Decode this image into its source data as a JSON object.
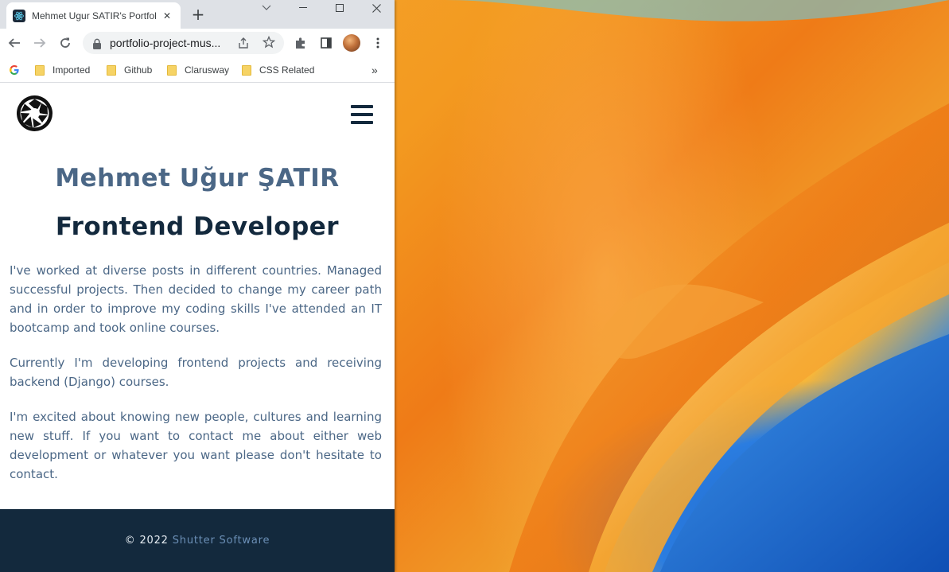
{
  "browser": {
    "tab": {
      "title": "Mehmet Ugur SATIR's Portfolio"
    },
    "address_bar": {
      "url": "portfolio-project-mus..."
    },
    "bookmarks": [
      {
        "label": "Imported"
      },
      {
        "label": "Github"
      },
      {
        "label": "Clarusway"
      },
      {
        "label": "CSS Related"
      }
    ],
    "bookmarks_overflow": "»"
  },
  "page": {
    "name": "Mehmet Uğur ŞATIR",
    "role": "Frontend Developer",
    "paragraphs": [
      "I've worked at diverse posts in different countries. Managed successful projects. Then decided to change my career path and in order to improve my coding skills I've attended an IT bootcamp and took online courses.",
      "Currently I'm developing frontend projects and receiving backend (Django) courses.",
      "I'm excited about knowing new people, cultures and learning new stuff. If you want to contact me about either web development or whatever you want please don't hesitate to contact."
    ],
    "footer": {
      "copyright": "© 2022",
      "company": "Shutter Software"
    }
  },
  "colors": {
    "navy": "#13293d",
    "slate": "#4b6786",
    "footer_link": "#6b8fb6"
  }
}
